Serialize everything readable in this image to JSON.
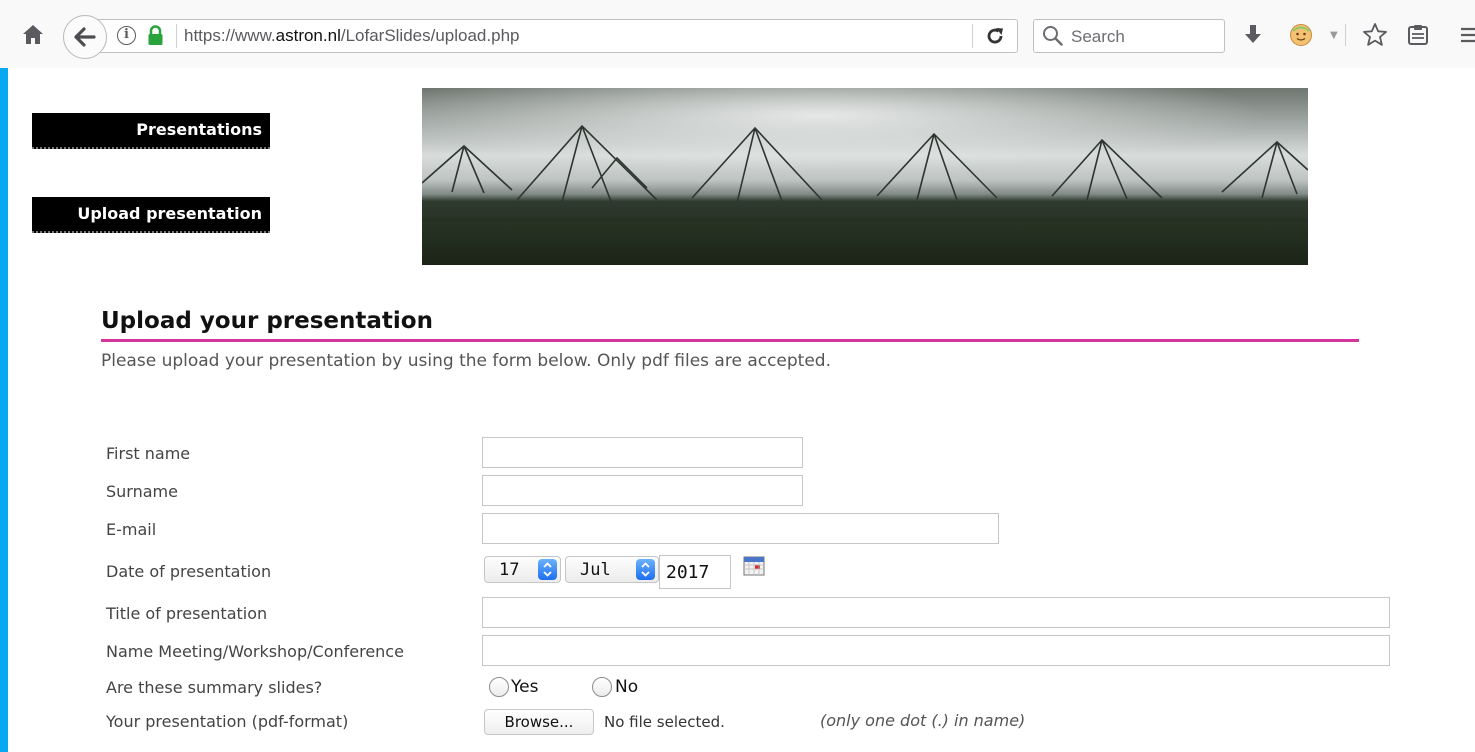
{
  "browser": {
    "url_prefix": "https://www.",
    "url_domain": "astron.nl",
    "url_path": "/LofarSlides/upload.php",
    "search_placeholder": "Search"
  },
  "nav": {
    "presentations": "Presentations",
    "upload": "Upload presentation"
  },
  "main": {
    "heading": "Upload your presentation",
    "intro": "Please upload your presentation by using the form below. Only pdf files are accepted."
  },
  "form": {
    "first_name": {
      "label": "First name",
      "value": ""
    },
    "surname": {
      "label": "Surname",
      "value": ""
    },
    "email": {
      "label": "E-mail",
      "value": ""
    },
    "date": {
      "label": "Date of presentation",
      "day": "17",
      "month": "Jul",
      "year": "2017"
    },
    "title": {
      "label": "Title of presentation",
      "value": ""
    },
    "meeting": {
      "label": "Name Meeting/Workshop/Conference",
      "value": ""
    },
    "summary": {
      "label": "Are these summary slides?",
      "options": [
        "Yes",
        "No"
      ],
      "selected": null
    },
    "file": {
      "label": "Your presentation (pdf-format)",
      "button": "Browse...",
      "status": "No file selected.",
      "hint": "(only one dot (.) in name)"
    }
  },
  "colors": {
    "accent_underline": "#d3359a",
    "nav_background": "#000000",
    "lock_green": "#2aa33c",
    "desktop_background": "#0aa8f0"
  }
}
